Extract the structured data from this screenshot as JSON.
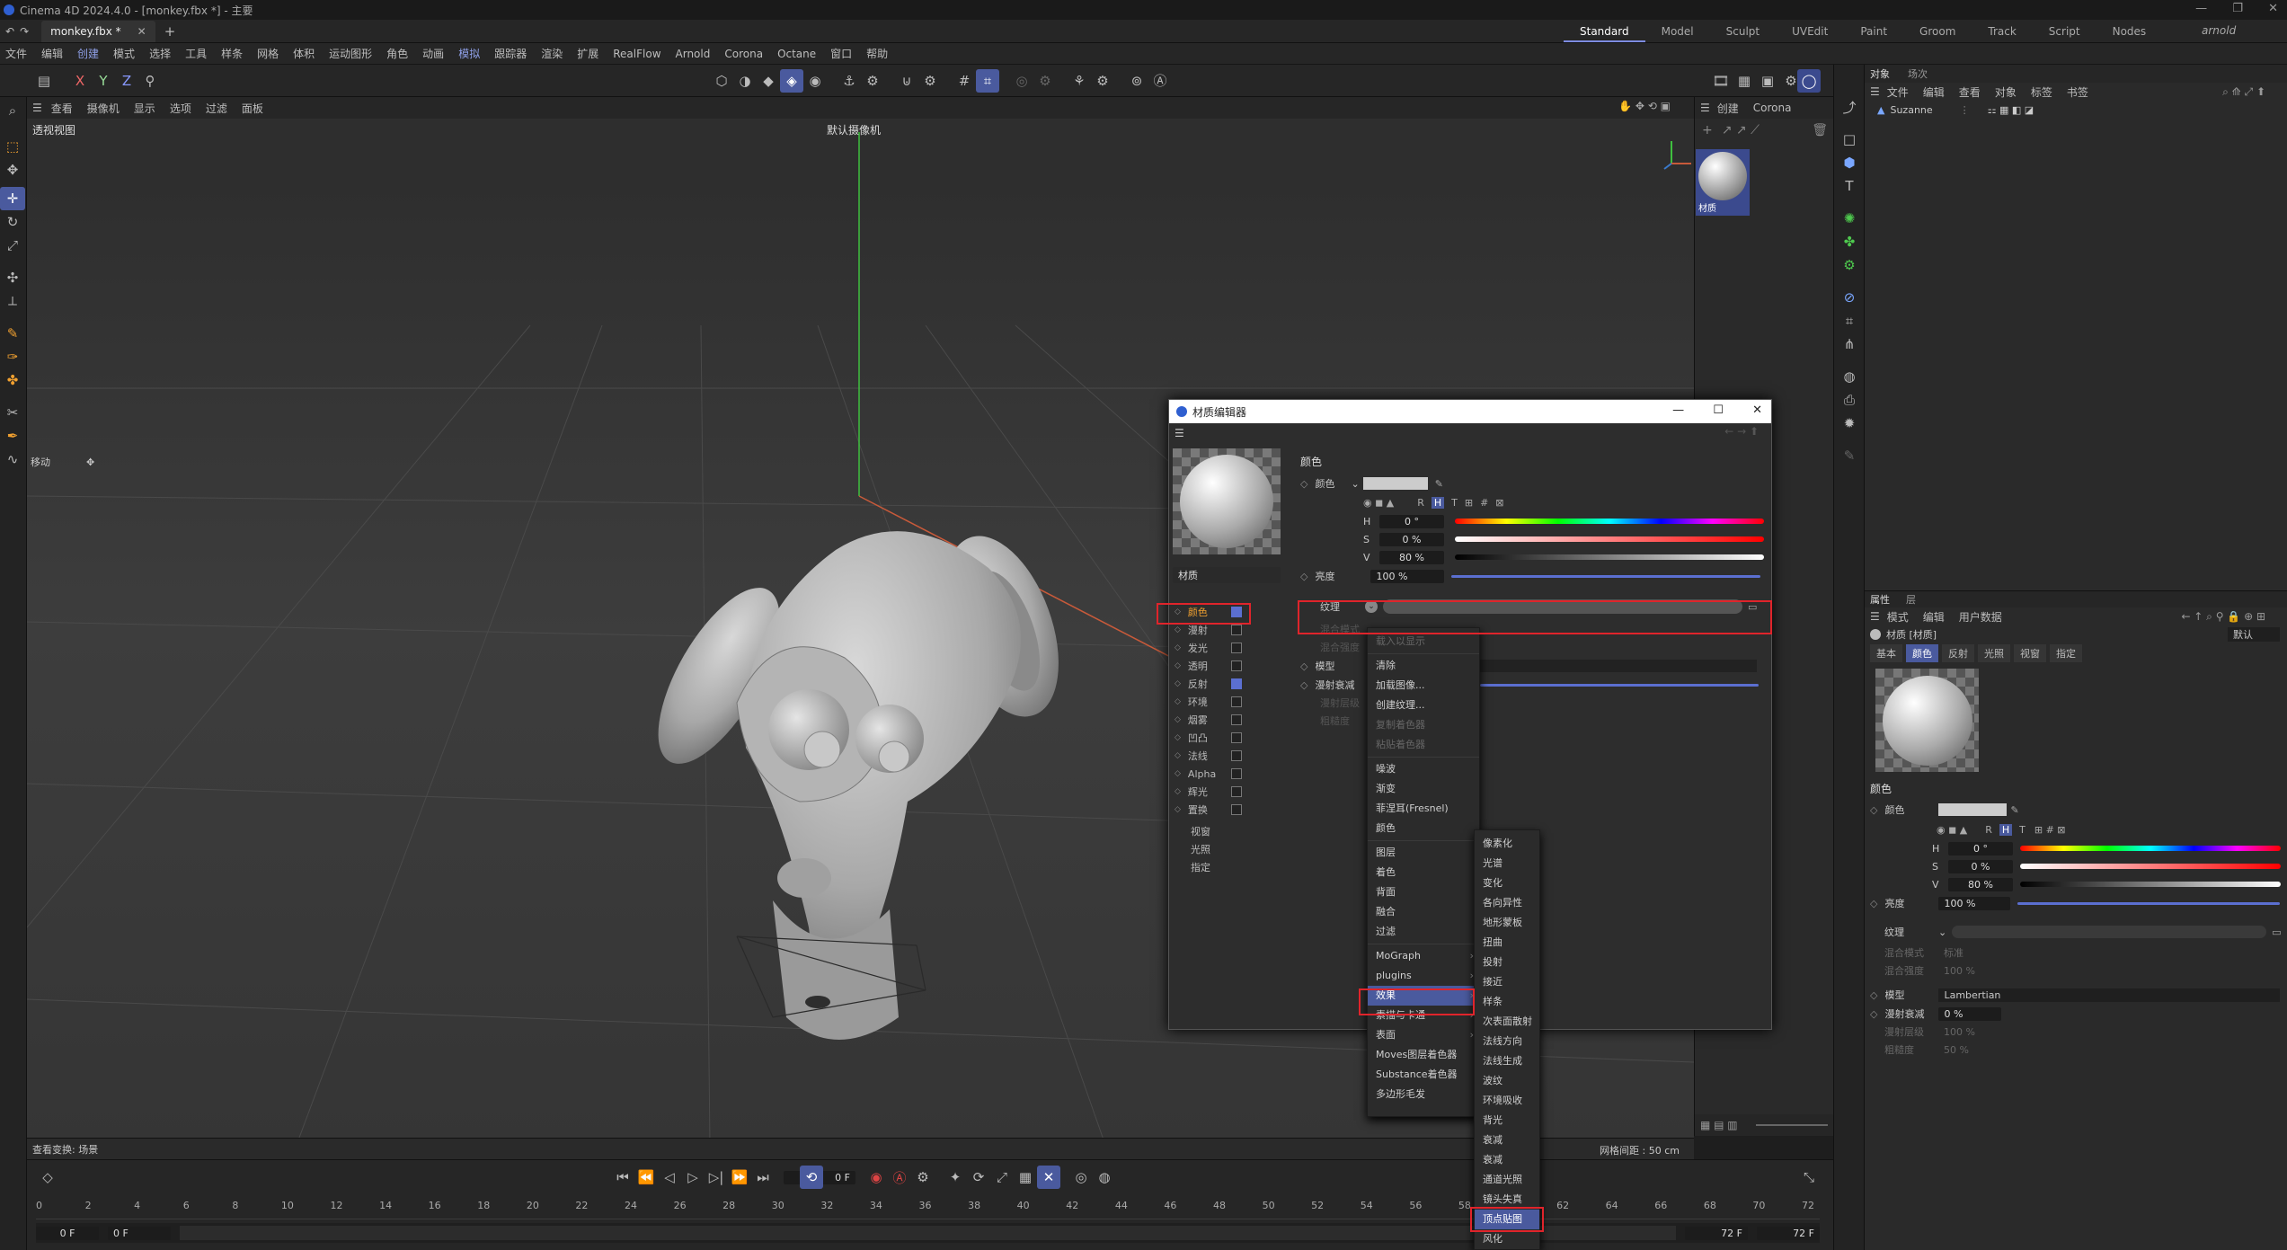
{
  "app": {
    "title": "Cinema 4D 2024.4.0 - [monkey.fbx *] - 主要"
  },
  "tabs": {
    "doc_tab": "monkey.fbx *",
    "layouts": [
      "Standard",
      "Model",
      "Sculpt",
      "UVEdit",
      "Paint",
      "Groom",
      "Track",
      "Script",
      "Nodes"
    ],
    "active_layout": "Standard",
    "user": "arnold"
  },
  "menubar": {
    "items": [
      "文件",
      "编辑",
      "创建",
      "模式",
      "选择",
      "工具",
      "样条",
      "网格",
      "体积",
      "运动图形",
      "角色",
      "动画",
      "模拟",
      "跟踪器",
      "渲染",
      "扩展",
      "RealFlow",
      "Arnold",
      "Corona",
      "Octane",
      "窗口",
      "帮助"
    ]
  },
  "toolbar": {
    "axes": [
      "X",
      "Y",
      "Z"
    ]
  },
  "viewport": {
    "menu": [
      "查看",
      "摄像机",
      "显示",
      "选项",
      "过滤",
      "面板"
    ],
    "view_name": "透视视图",
    "camera": "默认摄像机",
    "move_label": "移动",
    "status_left": "查看变换: 场景",
    "grid_spacing": "网格间距 : 50 cm"
  },
  "material_manager": {
    "menu": [
      "创建",
      "Corona"
    ],
    "material_name": "材质"
  },
  "object_manager": {
    "tabs": [
      "对象",
      "场次"
    ],
    "menu": [
      "文件",
      "编辑",
      "查看",
      "对象",
      "标签",
      "书签"
    ],
    "objects": [
      "Suzanne"
    ]
  },
  "attributes": {
    "tabs": [
      "属性",
      "层"
    ],
    "menu": [
      "模式",
      "编辑",
      "用户数据"
    ],
    "title": "材质 [材质]",
    "preset": "默认",
    "subtabs": [
      "基本",
      "颜色",
      "反射",
      "光照",
      "视窗",
      "指定"
    ],
    "active_subtab": "颜色",
    "section": "颜色",
    "color_label": "颜色",
    "h_label": "H",
    "h_value": "0 °",
    "s_label": "S",
    "s_value": "0 %",
    "v_label": "V",
    "v_value": "80 %",
    "brightness_label": "亮度",
    "brightness_value": "100 %",
    "texture_label": "纹理",
    "mix_mode_label": "混合模式",
    "mix_mode_value": "标准",
    "mix_strength_label": "混合强度",
    "mix_strength_value": "100 %",
    "model_label": "模型",
    "model_value": "Lambertian",
    "diffuse_falloff_label": "漫射衰减",
    "diffuse_falloff_value": "0 %",
    "diffuse_level_label": "漫射层级",
    "diffuse_level_value": "100 %",
    "roughness_label": "粗糙度",
    "roughness_value": "50 %",
    "color_modes": [
      "R",
      "H",
      "T"
    ]
  },
  "material_editor": {
    "title": "材质编辑器",
    "material_name": "材质",
    "channels": [
      {
        "name": "颜色",
        "checked": true
      },
      {
        "name": "漫射",
        "checked": false
      },
      {
        "name": "发光",
        "checked": false
      },
      {
        "name": "透明",
        "checked": false
      },
      {
        "name": "反射",
        "checked": true
      },
      {
        "name": "环境",
        "checked": false
      },
      {
        "name": "烟雾",
        "checked": false
      },
      {
        "name": "凹凸",
        "checked": false
      },
      {
        "name": "法线",
        "checked": false
      },
      {
        "name": "Alpha",
        "checked": false
      },
      {
        "name": "辉光",
        "checked": false
      },
      {
        "name": "置换",
        "checked": false
      },
      {
        "name": "视窗",
        "checked": null
      },
      {
        "name": "光照",
        "checked": null
      },
      {
        "name": "指定",
        "checked": null
      }
    ],
    "section": "颜色",
    "color_label": "颜色",
    "h_label": "H",
    "h_value": "0 °",
    "s_label": "S",
    "s_value": "0 %",
    "v_label": "V",
    "v_value": "80 %",
    "brightness_label": "亮度",
    "brightness_value": "100 %",
    "texture_label": "纹理",
    "mix_mode_label": "混合模式",
    "mix_strength_label": "混合强度",
    "model_label": "模型",
    "diffuse_falloff_label": "漫射衰减",
    "diffuse_level_label": "漫射层级",
    "roughness_label": "粗糙度",
    "color_modes": [
      "R",
      "H",
      "T",
      "#"
    ]
  },
  "context_menu": {
    "items": [
      {
        "label": "载入以显示",
        "dim": true
      },
      {
        "sep": true
      },
      {
        "label": "清除"
      },
      {
        "label": "加载图像..."
      },
      {
        "label": "创建纹理..."
      },
      {
        "label": "复制着色器",
        "dim": true
      },
      {
        "label": "粘贴着色器",
        "dim": true
      },
      {
        "sep": true
      },
      {
        "label": "噪波"
      },
      {
        "label": "渐变"
      },
      {
        "label": "菲涅耳(Fresnel)"
      },
      {
        "label": "颜色"
      },
      {
        "sep": true
      },
      {
        "label": "图层"
      },
      {
        "label": "着色"
      },
      {
        "label": "背面"
      },
      {
        "label": "融合"
      },
      {
        "label": "过滤"
      },
      {
        "sep": true
      },
      {
        "label": "MoGraph",
        "sub": true
      },
      {
        "label": "plugins",
        "sub": true
      },
      {
        "label": "效果",
        "sub": true,
        "active": true
      },
      {
        "label": "素描与卡通",
        "sub": true
      },
      {
        "label": "表面",
        "sub": true
      },
      {
        "label": "Moves图层着色器"
      },
      {
        "label": "Substance着色器"
      },
      {
        "label": "多边形毛发"
      }
    ],
    "submenu": [
      "像素化",
      "光谱",
      "变化",
      "各向异性",
      "地形蒙板",
      "扭曲",
      "投射",
      "接近",
      "样条",
      "次表面散射",
      "法线方向",
      "法线生成",
      "波纹",
      "环境吸收",
      "背光",
      "衰减",
      "衰减",
      "通道光照",
      "镜头失真",
      "顶点贴图",
      "风化"
    ],
    "highlighted_sub": "顶点贴图"
  },
  "timeline": {
    "current_frame": "0 F",
    "start_frame": "0 F",
    "start_frame2": "0 F",
    "end_frame": "72 F",
    "end_frame2": "72 F",
    "ticks": [
      "0",
      "2",
      "4",
      "6",
      "8",
      "10",
      "12",
      "14",
      "16",
      "18",
      "20",
      "22",
      "24",
      "26",
      "28",
      "30",
      "32",
      "34",
      "36",
      "38",
      "40",
      "42",
      "44",
      "46",
      "48",
      "50",
      "52",
      "54",
      "56",
      "58",
      "60",
      "62",
      "64",
      "66",
      "68",
      "70",
      "72"
    ]
  },
  "colors": {
    "accent": "#4a5a9e",
    "highlight_red": "#e0242b",
    "viewport_bg": "#3c3c3c"
  }
}
